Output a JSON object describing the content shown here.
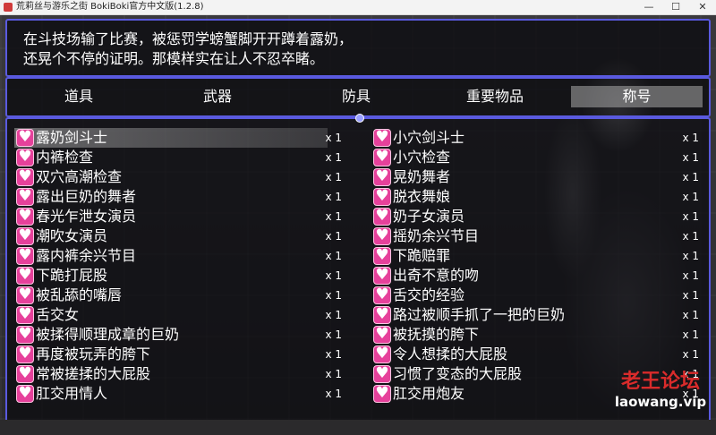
{
  "window": {
    "title": "荒莉丝与游乐之街 BokiBoki官方中文版(1.2.8)",
    "minimize": "—",
    "maximize": "☐",
    "close": "✕"
  },
  "help": {
    "line1": "在斗技场输了比赛，被惩罚学螃蟹脚开开蹲着露奶，",
    "line2": "还晃个不停的证明。那模样实在让人不忍卒睹。"
  },
  "categories": {
    "items": "道具",
    "weapons": "武器",
    "armor": "防具",
    "key_items": "重要物品",
    "titles": "称号",
    "selected": "称号"
  },
  "items": {
    "left": [
      {
        "name": "露奶剑斗士",
        "count": "x 1"
      },
      {
        "name": "内裤检查",
        "count": "x 1"
      },
      {
        "name": "双穴高潮检查",
        "count": "x 1"
      },
      {
        "name": "露出巨奶的舞者",
        "count": "x 1"
      },
      {
        "name": "春光乍泄女演员",
        "count": "x 1"
      },
      {
        "name": "潮吹女演员",
        "count": "x 1"
      },
      {
        "name": "露内裤余兴节目",
        "count": "x 1"
      },
      {
        "name": "下跪打屁股",
        "count": "x 1"
      },
      {
        "name": "被乱舔的嘴唇",
        "count": "x 1"
      },
      {
        "name": "舌交女",
        "count": "x 1"
      },
      {
        "name": "被揉得顺理成章的巨奶",
        "count": "x 1"
      },
      {
        "name": "再度被玩弄的胯下",
        "count": "x 1"
      },
      {
        "name": "常被搓揉的大屁股",
        "count": "x 1"
      },
      {
        "name": "肛交用情人",
        "count": "x 1"
      }
    ],
    "right": [
      {
        "name": "小穴剑斗士",
        "count": "x 1"
      },
      {
        "name": "小穴检查",
        "count": "x 1"
      },
      {
        "name": "晃奶舞者",
        "count": "x 1"
      },
      {
        "name": "脱衣舞娘",
        "count": "x 1"
      },
      {
        "name": "奶子女演员",
        "count": "x 1"
      },
      {
        "name": "摇奶余兴节目",
        "count": "x 1"
      },
      {
        "name": "下跪赔罪",
        "count": "x 1"
      },
      {
        "name": "出奇不意的吻",
        "count": "x 1"
      },
      {
        "name": "舌交的经验",
        "count": "x 1"
      },
      {
        "name": "路过被顺手抓了一把的巨奶",
        "count": "x 1"
      },
      {
        "name": "被抚摸的胯下",
        "count": "x 1"
      },
      {
        "name": "令人想揉的大屁股",
        "count": "x 1"
      },
      {
        "name": "习惯了变态的大屁股",
        "count": "x 1"
      },
      {
        "name": "肛交用炮友",
        "count": "x 1"
      }
    ]
  },
  "watermark": {
    "title": "老王论坛",
    "url": "laowang.vip"
  },
  "colors": {
    "frame": "#5a5adf",
    "heart_icon": "#e6419b",
    "watermark": "#d92b2b"
  }
}
